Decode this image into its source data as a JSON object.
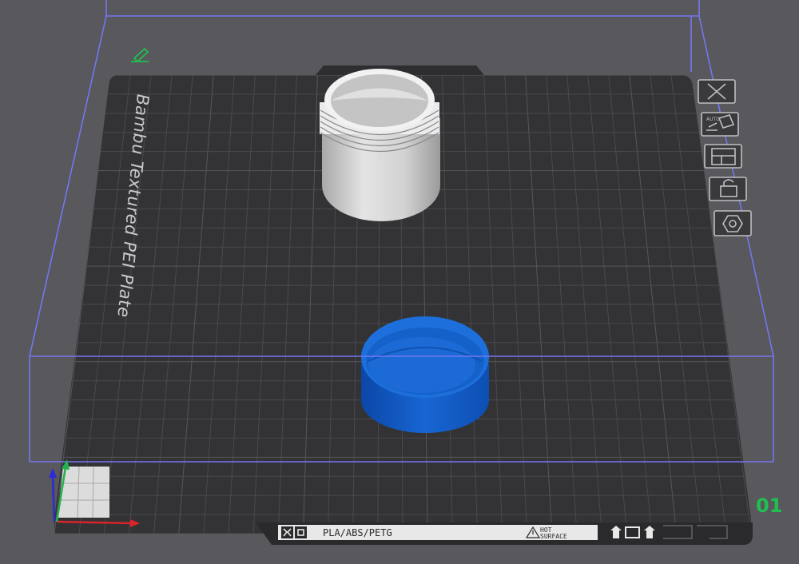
{
  "plate": {
    "name": "Bambu Textured PEI Plate",
    "number": "01",
    "label_strip": {
      "materials": "PLA/ABS/PETG",
      "warning_line1": "HOT",
      "warning_line2": "SURFACE"
    }
  },
  "plate_tools": [
    {
      "name": "remove-plate",
      "icon": "close-icon"
    },
    {
      "name": "auto-arrange",
      "icon": "auto-arrange-icon",
      "text": "AUTO"
    },
    {
      "name": "arrange",
      "icon": "layout-icon"
    },
    {
      "name": "lock",
      "icon": "lock-icon"
    },
    {
      "name": "settings",
      "icon": "hex-settings-icon"
    }
  ],
  "objects": [
    {
      "name": "jar-body",
      "color": "#d9d9d9"
    },
    {
      "name": "jar-lid",
      "color": "#1a63c8"
    }
  ],
  "colors": {
    "background": "#58585d",
    "plate": "#333336",
    "grid": "#49494d",
    "volume_outline": "#7476f2",
    "accent_green": "#20c050"
  }
}
